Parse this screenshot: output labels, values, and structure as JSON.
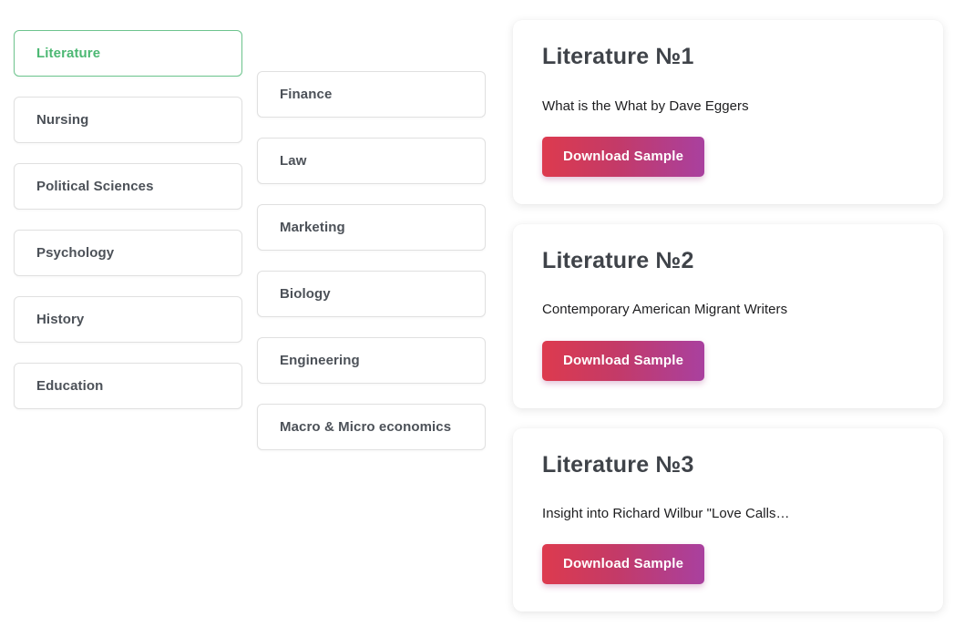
{
  "theme": {
    "page_background": "#ffffff",
    "accent_green": "#4cb873",
    "active_border": "#6ec48e",
    "item_border": "#e0e0e0",
    "heading_color": "#3f4349",
    "label_color": "#4c5158",
    "body_color": "#1d1d1f",
    "button_gradient_from": "#dd3a4e",
    "button_gradient_to": "#a9409f",
    "button_text_color": "#ffffff"
  },
  "categories": {
    "column_1": [
      {
        "label": "Literature",
        "active": true
      },
      {
        "label": "Nursing",
        "active": false
      },
      {
        "label": "Political Sciences",
        "active": false
      },
      {
        "label": "Psychology",
        "active": false
      },
      {
        "label": "History",
        "active": false
      },
      {
        "label": "Education",
        "active": false
      }
    ],
    "column_2": [
      {
        "label": "Finance",
        "active": false
      },
      {
        "label": "Law",
        "active": false
      },
      {
        "label": "Marketing",
        "active": false
      },
      {
        "label": "Biology",
        "active": false
      },
      {
        "label": "Engineering",
        "active": false
      },
      {
        "label": "Macro & Micro economics",
        "active": false
      }
    ]
  },
  "samples": [
    {
      "title": "Literature №1",
      "description": "What is the What by Dave Eggers",
      "button_label": "Download Sample"
    },
    {
      "title": "Literature №2",
      "description": "Contemporary American Migrant Writers",
      "button_label": "Download Sample"
    },
    {
      "title": "Literature №3",
      "description": "Insight into Richard Wilbur \"Love Calls…",
      "button_label": "Download Sample"
    }
  ]
}
